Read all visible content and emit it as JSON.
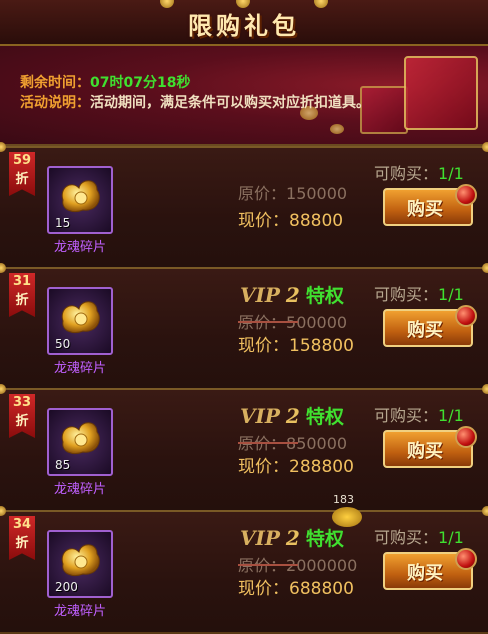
{
  "title": "限购礼包",
  "banner": {
    "time_label": "剩余时间：",
    "time_value": "07时07分18秒",
    "desc_label": "活动说明：",
    "desc_value": "活动期间，满足条件可以购买对应折扣道具。"
  },
  "labels": {
    "orig": "原价：",
    "now": "现价：",
    "limit": "可购买：",
    "buy": "购买",
    "zhe": "折",
    "vip": "VIP",
    "privilege": "特权"
  },
  "items": [
    {
      "discount": "59",
      "count": "15",
      "name": "龙魂碎片",
      "vip": "",
      "orig_price": "150000",
      "now_price": "88800",
      "limit": "1/1"
    },
    {
      "discount": "31",
      "count": "50",
      "name": "龙魂碎片",
      "vip": "2",
      "orig_price": "500000",
      "now_price": "158800",
      "limit": "1/1"
    },
    {
      "discount": "33",
      "count": "85",
      "name": "龙魂碎片",
      "vip": "2",
      "orig_price": "850000",
      "now_price": "288800",
      "limit": "1/1"
    },
    {
      "discount": "34",
      "count": "200",
      "name": "龙魂碎片",
      "vip": "2",
      "orig_price": "2000000",
      "now_price": "688800",
      "limit": "1/1"
    }
  ],
  "coin_counter": "183",
  "colors": {
    "accent_green": "#40e030",
    "label_orange": "#f0a030",
    "price_gold": "#f0c060",
    "item_purple": "#c060ff"
  }
}
